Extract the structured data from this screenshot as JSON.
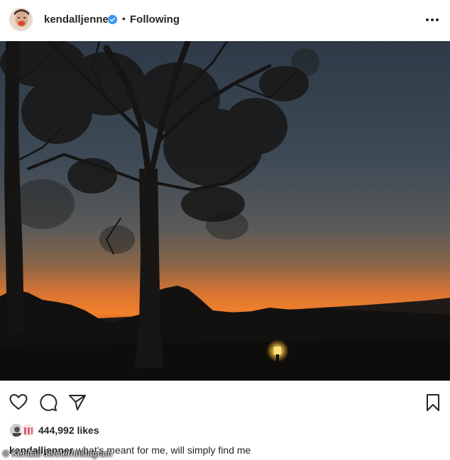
{
  "post": {
    "username": "kendalljenner",
    "follow_status": "Following",
    "separator": "•",
    "likes": "444,992 likes",
    "caption_user": "kendalljenner",
    "caption_text": "what's meant for me, will simply find me"
  },
  "watermark": "© Kendall Jenner/Instagram",
  "icons": {
    "verified": "verified-badge-icon",
    "more": "more-options-icon",
    "like": "heart-icon",
    "comment": "comment-icon",
    "share": "share-paper-plane-icon",
    "save": "bookmark-icon"
  },
  "colors": {
    "verified_blue": "#3897f0",
    "text": "#262626",
    "sky_top": "#2f3c4a",
    "horizon_orange": "#f07a2a"
  }
}
